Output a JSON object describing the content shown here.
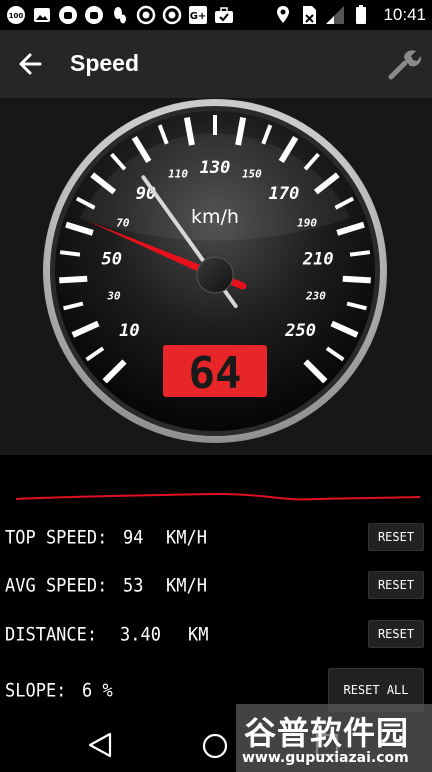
{
  "status_bar": {
    "time": "10:41",
    "notification_badge": "100",
    "left_icons": [
      "notification-100-icon",
      "image-icon",
      "android-debug-icon",
      "android-debug-icon",
      "footprint-icon",
      "record-icon",
      "record-icon",
      "google-plus-icon",
      "briefcase-icon"
    ],
    "right_icons": [
      "location-icon",
      "no-sim-icon",
      "signal-icon",
      "battery-icon"
    ]
  },
  "app_bar": {
    "title": "Speed",
    "back_icon": "arrow-left-icon",
    "settings_icon": "wrench-icon"
  },
  "gauge": {
    "unit": "km/h",
    "major_labels": [
      "10",
      "50",
      "90",
      "130",
      "170",
      "210",
      "250"
    ],
    "minor_labels": [
      "30",
      "70",
      "110",
      "150",
      "190",
      "230"
    ],
    "digital_speed": "64",
    "needle_speed": 64,
    "min_speed": 0,
    "max_speed": 260,
    "colors": {
      "needle": "#e8101a",
      "display_bg": "#e8262a",
      "display_text": "#1a1a1a",
      "bezel": "#c9c9c9"
    }
  },
  "graph": {
    "line_color": "#e01020"
  },
  "stats": {
    "top_speed": {
      "label": "TOP SPEED:",
      "value": "94",
      "unit": "KM/H",
      "reset_label": "RESET"
    },
    "avg_speed": {
      "label": "AVG SPEED:",
      "value": "53",
      "unit": "KM/H",
      "reset_label": "RESET"
    },
    "distance": {
      "label": "DISTANCE:",
      "value": "3.40",
      "unit": "KM",
      "reset_label": "RESET"
    },
    "slope": {
      "label": "SLOPE:",
      "value": "6 %"
    },
    "reset_all_label": "RESET ALL"
  },
  "nav_bar": {
    "icons": [
      "nav-back-icon",
      "nav-home-icon",
      "nav-recent-icon"
    ]
  },
  "watermark": {
    "title": "谷普软件园",
    "url": "www.gupuxiazai.com"
  }
}
